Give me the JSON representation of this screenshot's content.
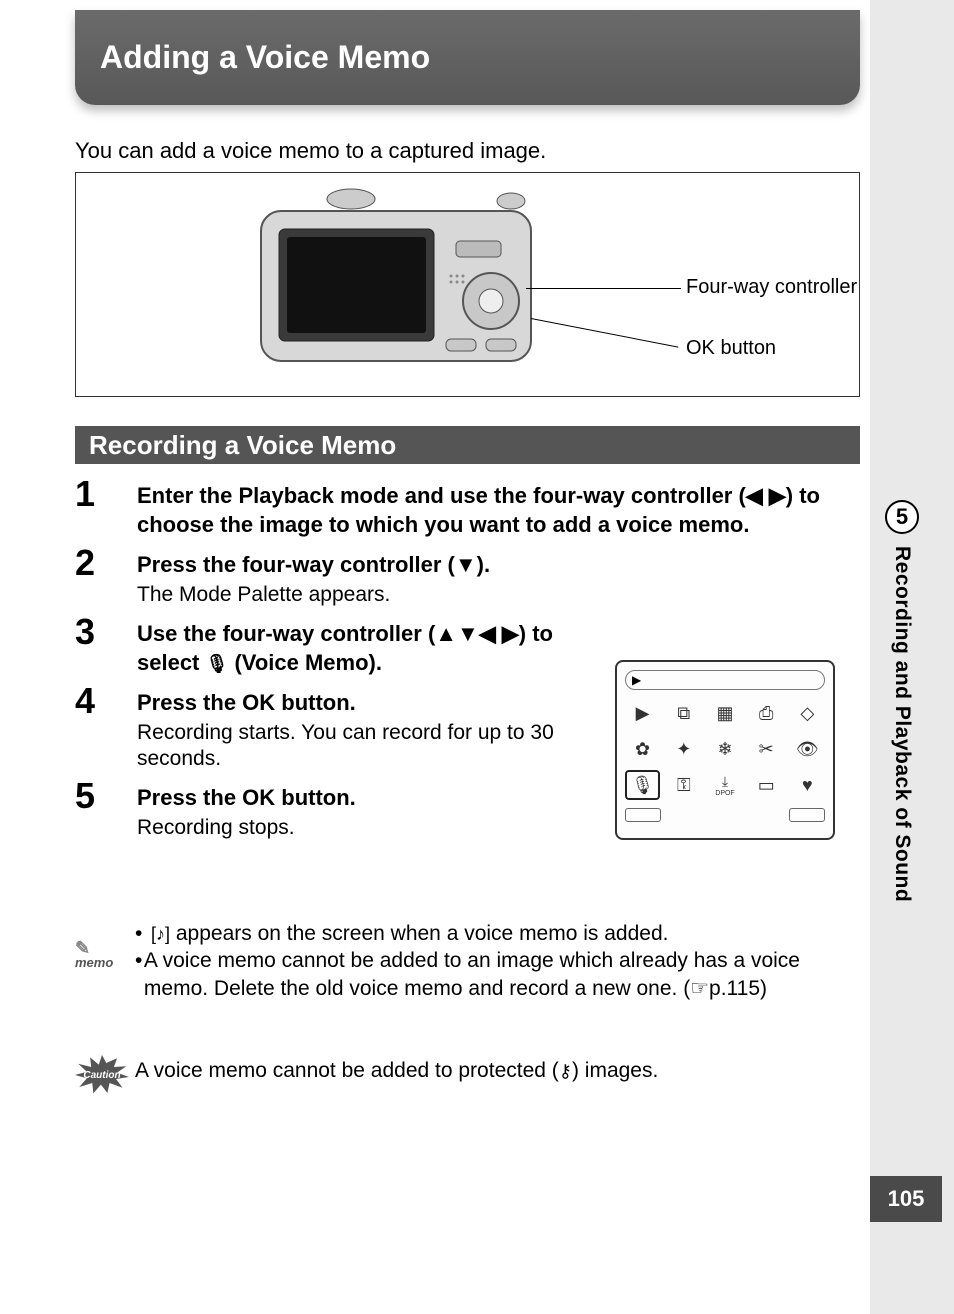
{
  "title": "Adding a Voice Memo",
  "intro": "You can add a voice memo to a captured image.",
  "diagram": {
    "label_fourway": "Four-way controller",
    "label_ok": "OK button"
  },
  "section_heading": "Recording a Voice Memo",
  "steps": [
    {
      "num": "1",
      "head": "Enter the Playback mode and use the four-way controller (◀ ▶) to choose the image to which you want to add a voice memo."
    },
    {
      "num": "2",
      "head": "Press the four-way controller (▼).",
      "sub": "The Mode Palette appears."
    },
    {
      "num": "3",
      "head_pre": "Use the four-way controller (▲▼◀ ▶) to select ",
      "head_icon": "🎙",
      "head_post": " (Voice Memo)."
    },
    {
      "num": "4",
      "head": "Press the OK button.",
      "sub": "Recording starts. You can record for up to 30 seconds."
    },
    {
      "num": "5",
      "head": "Press the OK button.",
      "sub": "Recording stops."
    }
  ],
  "palette": {
    "top_icon": "▶",
    "icons_row1": [
      "▶",
      "⧉",
      "▦",
      "⎙",
      "◇"
    ],
    "icons_row2": [
      "✿",
      "✦",
      "❄",
      "✂",
      "👁"
    ],
    "icons_row3": [
      "🎙",
      "⚿",
      "⤓",
      "▭",
      "♥"
    ],
    "row3_sub": "DPOF",
    "selected_index": 10
  },
  "memo": {
    "label": "memo",
    "bullets": [
      {
        "pre": "",
        "icon": "[♪]",
        "post": " appears on the screen when a voice memo is added."
      },
      {
        "pre": "A voice memo cannot be added to an image which already has a voice memo. Delete the old voice memo and record a new one. (",
        "icon": "☞",
        "post": "p.115)"
      }
    ]
  },
  "caution": {
    "label": "Caution",
    "text_pre": "A voice memo cannot be added to protected (",
    "icon": "⚷",
    "text_post": ") images."
  },
  "side": {
    "chapter": "5",
    "label": "Recording and Playback of Sound"
  },
  "page_number": "105"
}
